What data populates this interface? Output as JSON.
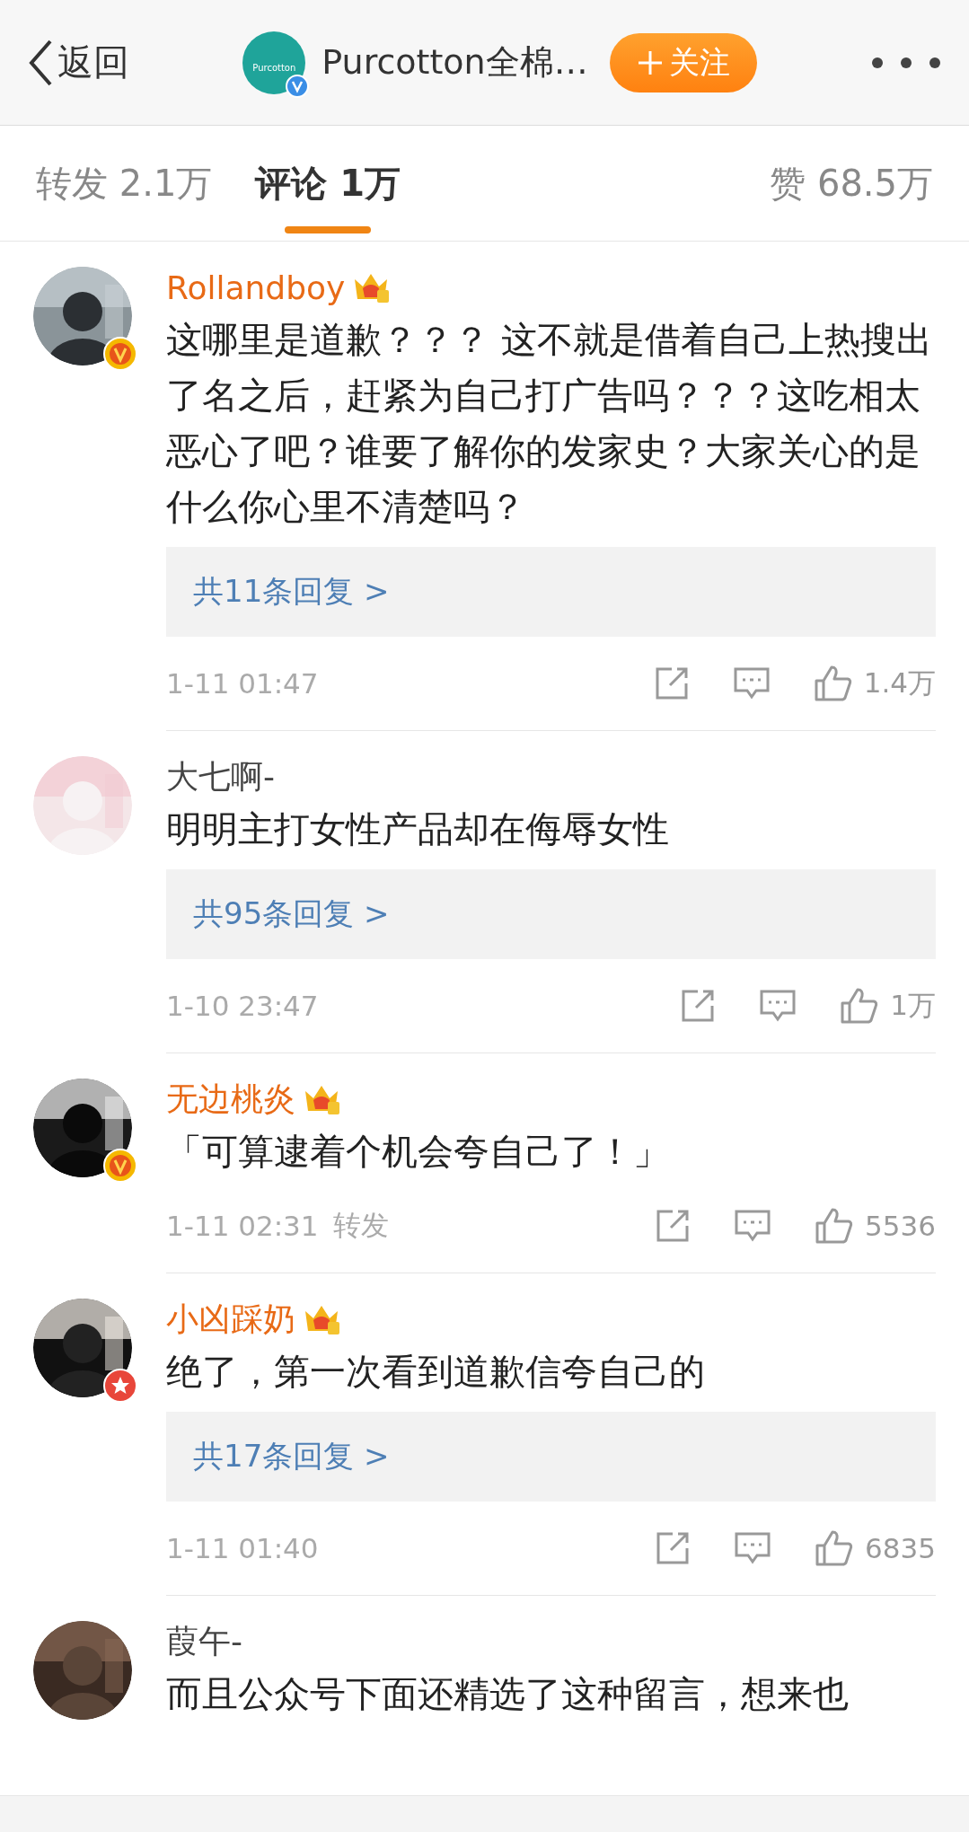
{
  "header": {
    "back_label": "返回",
    "logo_text": "Purcotton",
    "title": "Purcotton全棉…",
    "verified": true,
    "follow_label": "关注"
  },
  "tabs": [
    {
      "label": "转发 2.1万",
      "selected": false
    },
    {
      "label": "评论 1万",
      "selected": true
    },
    {
      "label": "赞 68.5万",
      "selected": false
    }
  ],
  "comments": [
    {
      "user": "Rollandboy",
      "crown": true,
      "badge": {
        "kind": "verified"
      },
      "text": "这哪里是道歉？？？ 这不就是借着自己上热搜出了名之后，赶紧为自己打广告吗？？？这吃相太恶心了吧？谁要了解你的发家史？大家关心的是什么你心里不清楚吗？",
      "replies": "共11条回复 >",
      "time": "1-11 01:47",
      "likes": "1.4万"
    },
    {
      "user": "大七啊-",
      "crown": false,
      "text": "明明主打女性产品却在侮辱女性",
      "replies": "共95条回复 >",
      "time": "1-10 23:47",
      "likes": "1万"
    },
    {
      "user": "无边桃炎",
      "crown": true,
      "badge": {
        "kind": "verified"
      },
      "text": "「可算逮着个机会夸自己了！」",
      "time": "1-11 02:31",
      "repost": "转发",
      "likes": "5536"
    },
    {
      "user": "小凶踩奶",
      "crown": true,
      "badge": {
        "kind": "star"
      },
      "text": "绝了，第一次看到道歉信夸自己的",
      "replies": "共17条回复 >",
      "time": "1-11 01:40",
      "likes": "6835"
    },
    {
      "user": "葭午-",
      "crown": false,
      "text": "而且公众号下面还精选了这种留言，想来也"
    }
  ]
}
